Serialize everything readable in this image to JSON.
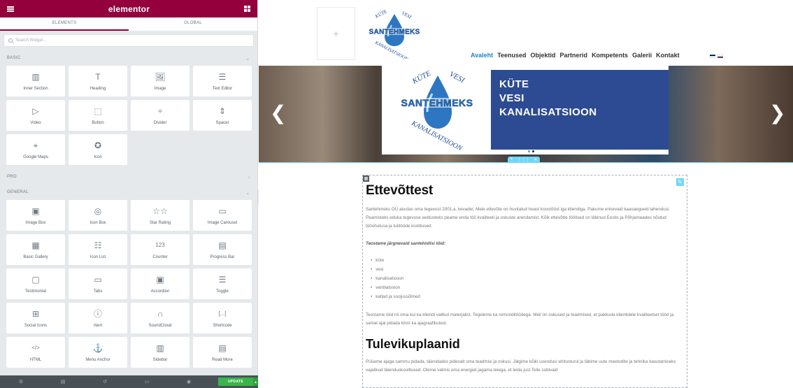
{
  "editor": {
    "brand": "elementor",
    "tabs": [
      "ELEMENTS",
      "GLOBAL"
    ],
    "search_placeholder": "Search Widget...",
    "categories": {
      "basic": "BASIC",
      "pro": "PRO",
      "general": "GENERAL"
    },
    "basic_widgets": [
      {
        "label": "Inner Section",
        "icon": "columns-icon"
      },
      {
        "label": "Heading",
        "icon": "heading-icon"
      },
      {
        "label": "Image",
        "icon": "image-icon"
      },
      {
        "label": "Text Editor",
        "icon": "text-editor-icon"
      },
      {
        "label": "Video",
        "icon": "video-icon"
      },
      {
        "label": "Button",
        "icon": "button-icon"
      },
      {
        "label": "Divider",
        "icon": "divider-icon"
      },
      {
        "label": "Spacer",
        "icon": "spacer-icon"
      },
      {
        "label": "Google Maps",
        "icon": "map-icon"
      },
      {
        "label": "Icon",
        "icon": "star-circle-icon"
      }
    ],
    "general_widgets": [
      {
        "label": "Image Box",
        "icon": "image-box-icon"
      },
      {
        "label": "Icon Box",
        "icon": "icon-box-icon"
      },
      {
        "label": "Star Rating",
        "icon": "star-rating-icon"
      },
      {
        "label": "Image Carousel",
        "icon": "carousel-icon"
      },
      {
        "label": "Basic Gallery",
        "icon": "gallery-icon"
      },
      {
        "label": "Icon List",
        "icon": "icon-list-icon"
      },
      {
        "label": "Counter",
        "icon": "counter-icon"
      },
      {
        "label": "Progress Bar",
        "icon": "progress-bar-icon"
      },
      {
        "label": "Testimonial",
        "icon": "testimonial-icon"
      },
      {
        "label": "Tabs",
        "icon": "tabs-icon"
      },
      {
        "label": "Accordion",
        "icon": "accordion-icon"
      },
      {
        "label": "Toggle",
        "icon": "toggle-icon"
      },
      {
        "label": "Social Icons",
        "icon": "social-icons-icon"
      },
      {
        "label": "Alert",
        "icon": "alert-icon"
      },
      {
        "label": "SoundCloud",
        "icon": "headphones-icon"
      },
      {
        "label": "Shortcode",
        "icon": "shortcode-icon"
      },
      {
        "label": "HTML",
        "icon": "code-icon"
      },
      {
        "label": "Menu Anchor",
        "icon": "anchor-icon"
      },
      {
        "label": "Sidebar",
        "icon": "sidebar-icon"
      },
      {
        "label": "Read More",
        "icon": "read-more-icon"
      }
    ],
    "footer": {
      "update_label": "UPDATE"
    },
    "colors": {
      "header": "#93003c",
      "footer": "#495157",
      "update": "#39b54a"
    }
  },
  "site": {
    "logo_text_top": "KÜTE VESI",
    "logo_brand": "SANTEHMEKS",
    "logo_text_bottom": "KANALISATSIOON",
    "nav": [
      "Avaleht",
      "Teenused",
      "Objektid",
      "Partnerid",
      "Kompetents",
      "Galerii",
      "Kontakt"
    ],
    "slider": {
      "lines": [
        "KÜTE",
        "VESI",
        "KANALISATSIOON"
      ]
    },
    "content": {
      "heading1": "Ettevõttest",
      "para1": "Santehmeks OÜ alustas oma tegevust 2001.a. kevadel. Meie ettevõte on huvitatud heast koostööst iga kliendiga. Pakume erinevaid kaasaegseid lahendusi. Peamisteks eduka tegevuse eeldusteks peame enda töö kvaliteeti ja oskuste arendamist. Kõik ettevõtte töölised on läbinud Eestis ja Põhjamaades nõutud tööohutusa ja tulitööde koolitused.",
      "subheading": "Teostame järgnevaid santehnilisi töid:",
      "list": [
        "küte",
        "vesi",
        "kanalisatsioon",
        "ventilatsioon",
        "katlad ja soojussõlmed"
      ],
      "para2": "Teostame töid nii oma kui ka kliendi valitud materjalist. Tegeleme ka remonditöödega. Meil on oskused ja teadmised, et pakkuda klientidele kvaliteetset tööd ja samal ajal pidada kinni ka ajagraafikutest.",
      "heading2": "Tulevikuplaanid",
      "para3": "Püüame ajaga sammu pidada, täiendades pidevalt oma teadmisi ja oskusi. Jälgime kõiki uuendusi ehitusturul ja läbime uute meetodite ja tehnika kasutamiseks vajalikud täienduskoolitused. Oleme valmis oma energiat jagama teiega, et leida just Teile sobivaid"
    },
    "colors": {
      "accent": "#1d86c8",
      "slide_box": "#2c4b92",
      "editor_outline": "#71d7f7"
    }
  }
}
